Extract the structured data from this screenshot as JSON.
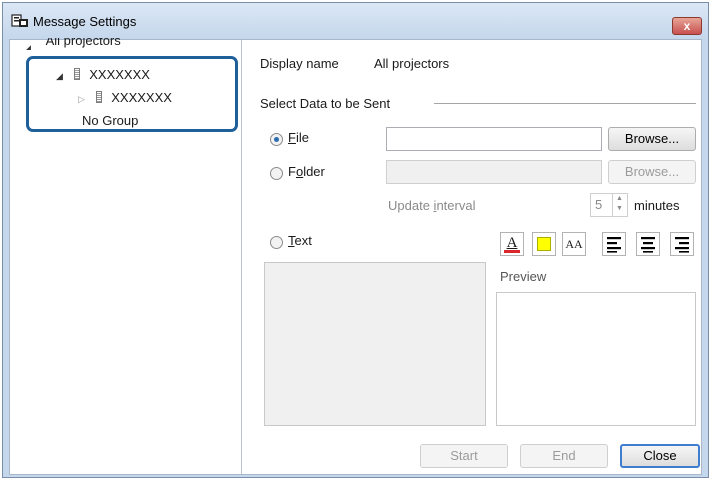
{
  "window": {
    "title": "Message Settings",
    "close_label": "x"
  },
  "tree": {
    "root": "All projectors",
    "group": "XXXXXXX",
    "child": "XXXXXXX",
    "no_group": "No Group"
  },
  "display": {
    "label": "Display name",
    "value": "All projectors"
  },
  "select_data": {
    "label": "Select Data to be Sent",
    "file": {
      "label_first": "F",
      "label_rest": "ile",
      "checked": true,
      "value": "",
      "browse": "Browse..."
    },
    "folder": {
      "label_first": "F",
      "label_mid": "o",
      "label_rest": "lder",
      "checked": false,
      "value": "",
      "browse": "Browse..."
    },
    "update_interval": {
      "label_pre": "Update ",
      "label_u": "i",
      "label_post": "nterval",
      "value": "5",
      "unit": "minutes"
    },
    "text": {
      "label_first": "T",
      "label_rest": "ext",
      "checked": false
    }
  },
  "format_buttons": {
    "font_color_glyph": "A",
    "font_size_glyph": "AA",
    "highlight_color": "#ffff00",
    "font_color": "#d9272e"
  },
  "preview": {
    "label": "Preview"
  },
  "footer": {
    "start": "Start",
    "end": "End",
    "close": "Close"
  }
}
